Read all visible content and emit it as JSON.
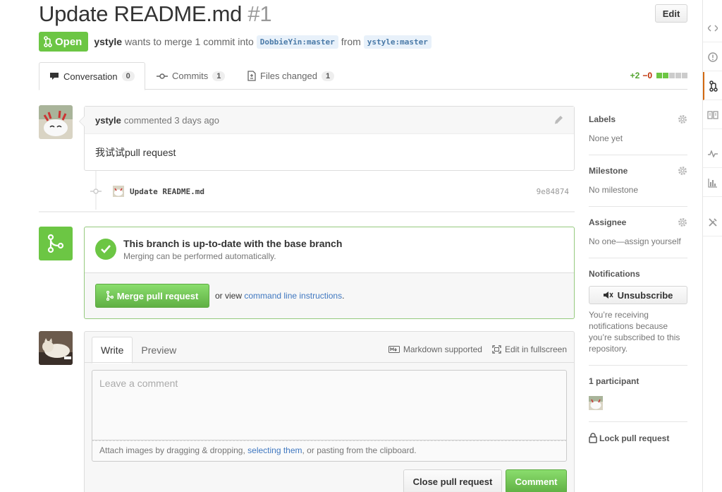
{
  "pr": {
    "title": "Update README.md",
    "number": "#1",
    "edit_label": "Edit",
    "state": "Open",
    "author": "ystyle",
    "merge_text": "wants to merge 1 commit into",
    "base_ref": "DobbieYin:master",
    "from_text": "from",
    "head_ref": "ystyle:master"
  },
  "tabs": [
    {
      "label": "Conversation",
      "count": "0"
    },
    {
      "label": "Commits",
      "count": "1"
    },
    {
      "label": "Files changed",
      "count": "1"
    }
  ],
  "diffstat": {
    "additions": "+2",
    "deletions": "−0",
    "colors": [
      "#6cc644",
      "#6cc644",
      "#ccc",
      "#ccc",
      "#ccc"
    ]
  },
  "comment": {
    "author": "ystyle",
    "meta": "commented 3 days ago",
    "body": "我试试pull request"
  },
  "commit": {
    "message": "Update README.md",
    "sha": "9e84874"
  },
  "merge": {
    "title": "This branch is up-to-date with the base branch",
    "subtitle": "Merging can be performed automatically.",
    "button": "Merge pull request",
    "alt_prefix": "or view",
    "alt_link": "command line instructions",
    "alt_suffix": "."
  },
  "composer": {
    "tab_write": "Write",
    "tab_preview": "Preview",
    "markdown_hint": "Markdown supported",
    "fullscreen_hint": "Edit in fullscreen",
    "placeholder": "Leave a comment",
    "attach_prefix": "Attach images by dragging & dropping,",
    "attach_link": "selecting them",
    "attach_suffix": ", or pasting from the clipboard.",
    "close_button": "Close pull request",
    "comment_button": "Comment"
  },
  "sidebar": {
    "labels_title": "Labels",
    "labels_value": "None yet",
    "milestone_title": "Milestone",
    "milestone_value": "No milestone",
    "assignee_title": "Assignee",
    "assignee_value": "No one—assign yourself",
    "notifications_title": "Notifications",
    "unsubscribe_label": "Unsubscribe",
    "notifications_text": "You’re receiving notifications because you’re subscribed to this repository.",
    "participants_title": "1 participant",
    "lock_label": "Lock pull request"
  },
  "colors": {
    "green": "#6cc644",
    "link": "#4078c0",
    "accent": "#d26911"
  }
}
